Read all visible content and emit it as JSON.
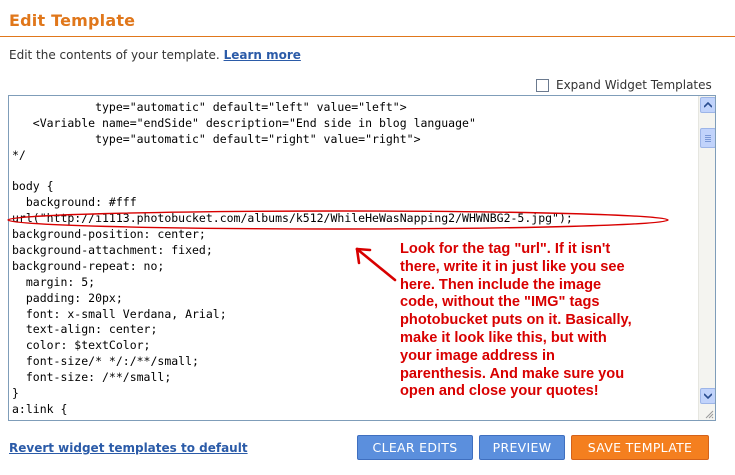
{
  "header": {
    "title": "Edit Template",
    "description": "Edit the contents of your template.",
    "learn_more": "Learn more"
  },
  "expand_widget": {
    "label": "Expand Widget Templates",
    "checked": false
  },
  "editor": {
    "code_lines": [
      "            type=\"automatic\" default=\"left\" value=\"left\">",
      "   <Variable name=\"endSide\" description=\"End side in blog language\"",
      "            type=\"automatic\" default=\"right\" value=\"right\">",
      "*/",
      "",
      "body {",
      "  background: #fff",
      "url(\"http://i1113.photobucket.com/albums/k512/WhileHeWasNapping2/WHWNBG2-5.jpg\");",
      "background-position: center;",
      "background-attachment: fixed;",
      "background-repeat: no;",
      "  margin: 5;",
      "  padding: 20px;",
      "  font: x-small Verdana, Arial;",
      "  text-align: center;",
      "  color: $textColor;",
      "  font-size/* */:/**/small;",
      "  font-size: /**/small;",
      "}",
      "a:link {"
    ]
  },
  "annotation": {
    "text": "Look for the tag \"url\".  If it isn't there, write it in just like you see here.  Then include the image code, without the \"IMG\" tags photobucket puts on it.  Basically, make it look like this, but with your image address in parenthesis.  And make sure you open and close your quotes!",
    "color": "#d80000"
  },
  "footer": {
    "revert_link": "Revert widget templates to default",
    "clear_edits": "CLEAR EDITS",
    "preview": "PREVIEW",
    "save_template": "SAVE TEMPLATE"
  },
  "colors": {
    "accent": "#e0771b",
    "link": "#2b5ba8",
    "button_blue": "#5b8fdd",
    "button_orange": "#f47f1f"
  }
}
